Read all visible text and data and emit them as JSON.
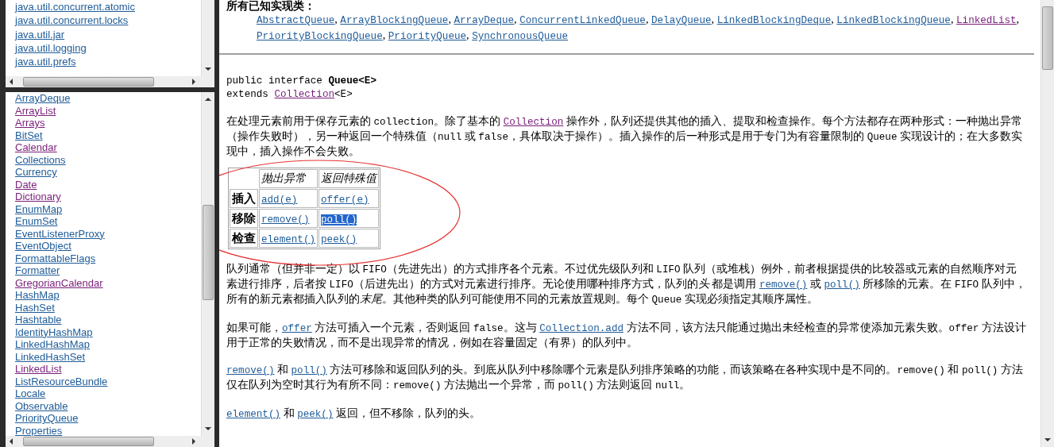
{
  "packages": {
    "items": [
      {
        "label": "java.util.concurrent.atomic",
        "visited": false
      },
      {
        "label": "java.util.concurrent.locks",
        "visited": false
      },
      {
        "label": "java.util.jar",
        "visited": false
      },
      {
        "label": "java.util.logging",
        "visited": false
      },
      {
        "label": "java.util.prefs",
        "visited": false
      }
    ]
  },
  "classes": {
    "items": [
      {
        "label": "ArrayDeque",
        "visited": false
      },
      {
        "label": "ArrayList",
        "visited": true
      },
      {
        "label": "Arrays",
        "visited": true
      },
      {
        "label": "BitSet",
        "visited": false
      },
      {
        "label": "Calendar",
        "visited": true
      },
      {
        "label": "Collections",
        "visited": false
      },
      {
        "label": "Currency",
        "visited": false
      },
      {
        "label": "Date",
        "visited": true
      },
      {
        "label": "Dictionary",
        "visited": true
      },
      {
        "label": "EnumMap",
        "visited": false
      },
      {
        "label": "EnumSet",
        "visited": false
      },
      {
        "label": "EventListenerProxy",
        "visited": false
      },
      {
        "label": "EventObject",
        "visited": false
      },
      {
        "label": "FormattableFlags",
        "visited": false
      },
      {
        "label": "Formatter",
        "visited": false
      },
      {
        "label": "GregorianCalendar",
        "visited": true
      },
      {
        "label": "HashMap",
        "visited": false
      },
      {
        "label": "HashSet",
        "visited": false
      },
      {
        "label": "Hashtable",
        "visited": false
      },
      {
        "label": "IdentityHashMap",
        "visited": false
      },
      {
        "label": "LinkedHashMap",
        "visited": false
      },
      {
        "label": "LinkedHashSet",
        "visited": false
      },
      {
        "label": "LinkedList",
        "visited": true
      },
      {
        "label": "ListResourceBundle",
        "visited": false
      },
      {
        "label": "Locale",
        "visited": false
      },
      {
        "label": "Observable",
        "visited": false
      },
      {
        "label": "PriorityQueue",
        "visited": false
      },
      {
        "label": "Properties",
        "visited": false
      }
    ]
  },
  "doc": {
    "implementing_heading": "所有已知实现类：",
    "implementing_classes": [
      {
        "kind": "link",
        "text": "AbstractQueue",
        "visited": false
      },
      {
        "kind": "text",
        "text": ", "
      },
      {
        "kind": "link",
        "text": "ArrayBlockingQueue",
        "visited": false
      },
      {
        "kind": "text",
        "text": ", "
      },
      {
        "kind": "link",
        "text": "ArrayDeque",
        "visited": false
      },
      {
        "kind": "text",
        "text": ", "
      },
      {
        "kind": "link",
        "text": "ConcurrentLinkedQueue",
        "visited": false
      },
      {
        "kind": "text",
        "text": ", "
      },
      {
        "kind": "link",
        "text": "DelayQueue",
        "visited": false
      },
      {
        "kind": "text",
        "text": ", "
      },
      {
        "kind": "link",
        "text": "LinkedBlockingDeque",
        "visited": false
      },
      {
        "kind": "text",
        "text": ", "
      },
      {
        "kind": "link",
        "text": "LinkedBlockingQueue",
        "visited": false
      },
      {
        "kind": "text",
        "text": ", "
      },
      {
        "kind": "link",
        "text": "LinkedList",
        "visited": true
      },
      {
        "kind": "text",
        "text": ", "
      },
      {
        "kind": "link",
        "text": "PriorityBlockingQueue",
        "visited": false
      },
      {
        "kind": "text",
        "text": ", "
      },
      {
        "kind": "link",
        "text": "PriorityQueue",
        "visited": false
      },
      {
        "kind": "text",
        "text": ", "
      },
      {
        "kind": "link",
        "text": "SynchronousQueue",
        "visited": false
      }
    ],
    "signature_lines": [
      [
        {
          "kind": "code",
          "text": "public interface "
        },
        {
          "kind": "bold",
          "text": "Queue<E>"
        }
      ],
      [
        {
          "kind": "code",
          "text": "extends "
        },
        {
          "kind": "link",
          "text": "Collection",
          "visited": true
        },
        {
          "kind": "code",
          "text": "<E>"
        }
      ]
    ],
    "intro": [
      {
        "kind": "text",
        "text": "在处理元素前用于保存元素的 "
      },
      {
        "kind": "code",
        "text": "collection"
      },
      {
        "kind": "text",
        "text": "。除了基本的 "
      },
      {
        "kind": "link",
        "text": "Collection",
        "visited": true
      },
      {
        "kind": "text",
        "text": " 操作外，队列还提供其他的插入、提取和检查操作。每个方法都存在两种形式：一种抛出异常（操作失败时），另一种返回一个特殊值（"
      },
      {
        "kind": "code",
        "text": "null"
      },
      {
        "kind": "text",
        "text": " 或 "
      },
      {
        "kind": "code",
        "text": "false"
      },
      {
        "kind": "text",
        "text": "，具体取决于操作）。插入操作的后一种形式是用于专门为有容量限制的 "
      },
      {
        "kind": "code",
        "text": "Queue"
      },
      {
        "kind": "text",
        "text": " 实现设计的；在大多数实现中，插入操作不会失败。"
      }
    ],
    "summary_table": {
      "columns": [
        "抛出异常",
        "返回特殊值"
      ],
      "rows": [
        {
          "label": "插入",
          "cells": [
            {
              "text": "add(e)",
              "selected": false
            },
            {
              "text": "offer(e)",
              "selected": false
            }
          ]
        },
        {
          "label": "移除",
          "cells": [
            {
              "text": "remove()",
              "selected": false
            },
            {
              "text": "poll()",
              "selected": true
            }
          ]
        },
        {
          "label": "检查",
          "cells": [
            {
              "text": "element()",
              "selected": false
            },
            {
              "text": "peek()",
              "selected": false
            }
          ]
        }
      ]
    },
    "paragraphs": [
      [
        {
          "kind": "text",
          "text": "队列通常（但并非一定）以 "
        },
        {
          "kind": "code",
          "text": "FIFO"
        },
        {
          "kind": "text",
          "text": "（先进先出）的方式排序各个元素。不过优先级队列和 "
        },
        {
          "kind": "code",
          "text": "LIFO"
        },
        {
          "kind": "text",
          "text": " 队列（或堆栈）例外，前者根据提供的比较器或元素的自然顺序对元素进行排序，后者按 "
        },
        {
          "kind": "code",
          "text": "LIFO"
        },
        {
          "kind": "text",
          "text": "（后进先出）的方式对元素进行排序。无论使用哪种排序方式，队列的"
        },
        {
          "kind": "em",
          "text": "头"
        },
        {
          "kind": "text",
          "text": " 都是调用 "
        },
        {
          "kind": "link",
          "text": "remove()",
          "visited": false
        },
        {
          "kind": "text",
          "text": " 或 "
        },
        {
          "kind": "link",
          "text": "poll()",
          "visited": false
        },
        {
          "kind": "text",
          "text": " 所移除的元素。在 "
        },
        {
          "kind": "code",
          "text": "FIFO"
        },
        {
          "kind": "text",
          "text": " 队列中，所有的新元素都插入队列的"
        },
        {
          "kind": "em",
          "text": "末尾"
        },
        {
          "kind": "text",
          "text": "。其他种类的队列可能使用不同的元素放置规则。每个 "
        },
        {
          "kind": "code",
          "text": "Queue"
        },
        {
          "kind": "text",
          "text": " 实现必须指定其顺序属性。"
        }
      ],
      [
        {
          "kind": "text",
          "text": "如果可能，"
        },
        {
          "kind": "link",
          "text": "offer",
          "visited": false
        },
        {
          "kind": "text",
          "text": " 方法可插入一个元素，否则返回 "
        },
        {
          "kind": "code",
          "text": "false"
        },
        {
          "kind": "text",
          "text": "。这与 "
        },
        {
          "kind": "link",
          "text": "Collection.add",
          "visited": false
        },
        {
          "kind": "text",
          "text": " 方法不同，该方法只能通过抛出未经检查的异常使添加元素失败。"
        },
        {
          "kind": "code",
          "text": "offer"
        },
        {
          "kind": "text",
          "text": " 方法设计用于正常的失败情况，而不是出现异常的情况，例如在容量固定（有界）的队列中。"
        }
      ],
      [
        {
          "kind": "link",
          "text": "remove()",
          "visited": false
        },
        {
          "kind": "text",
          "text": " 和 "
        },
        {
          "kind": "link",
          "text": "poll()",
          "visited": false
        },
        {
          "kind": "text",
          "text": " 方法可移除和返回队列的头。到底从队列中移除哪个元素是队列排序策略的功能，而该策略在各种实现中是不同的。"
        },
        {
          "kind": "code",
          "text": "remove()"
        },
        {
          "kind": "text",
          "text": " 和 "
        },
        {
          "kind": "code",
          "text": "poll()"
        },
        {
          "kind": "text",
          "text": " 方法仅在队列为空时其行为有所不同："
        },
        {
          "kind": "code",
          "text": "remove()"
        },
        {
          "kind": "text",
          "text": " 方法抛出一个异常，而 "
        },
        {
          "kind": "code",
          "text": "poll()"
        },
        {
          "kind": "text",
          "text": " 方法则返回 "
        },
        {
          "kind": "code",
          "text": "null"
        },
        {
          "kind": "text",
          "text": "。"
        }
      ],
      [
        {
          "kind": "link",
          "text": "element()",
          "visited": false
        },
        {
          "kind": "text",
          "text": " 和 "
        },
        {
          "kind": "link",
          "text": "peek()",
          "visited": false
        },
        {
          "kind": "text",
          "text": " 返回，但不移除，队列的头。"
        }
      ]
    ]
  }
}
